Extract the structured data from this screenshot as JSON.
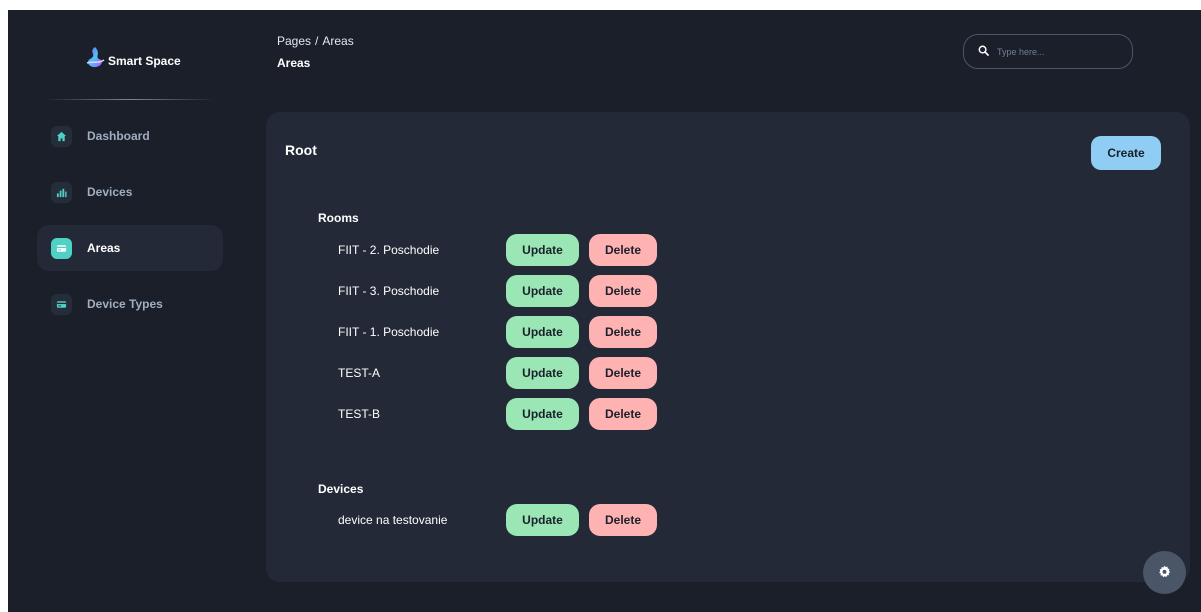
{
  "brand": {
    "name": "Smart Space"
  },
  "sidebar": {
    "items": [
      {
        "label": "Dashboard",
        "icon": "home-icon"
      },
      {
        "label": "Devices",
        "icon": "chart-bars-icon"
      },
      {
        "label": "Areas",
        "icon": "card-icon",
        "active": true
      },
      {
        "label": "Device Types",
        "icon": "card-icon"
      }
    ]
  },
  "header": {
    "breadcrumb_parent": "Pages",
    "breadcrumb_separator": "/",
    "breadcrumb_current": "Areas",
    "title": "Areas"
  },
  "search": {
    "placeholder": "Type here..."
  },
  "card": {
    "title": "Root",
    "create_label": "Create",
    "rooms_title": "Rooms",
    "rooms": [
      {
        "name": "FIIT - 2. Poschodie"
      },
      {
        "name": "FIIT - 3. Poschodie"
      },
      {
        "name": "FIIT - 1. Poschodie"
      },
      {
        "name": "TEST-A"
      },
      {
        "name": "TEST-B"
      }
    ],
    "devices_title": "Devices",
    "devices": [
      {
        "name": "device na testovanie"
      }
    ],
    "update_label": "Update",
    "delete_label": "Delete"
  },
  "colors": {
    "background": "#1a1f2a",
    "card": "#232936",
    "accent_teal": "#4fd1c5",
    "create_button": "#90cdf4",
    "update_button": "#9ae6b4",
    "delete_button": "#feb2b2"
  }
}
